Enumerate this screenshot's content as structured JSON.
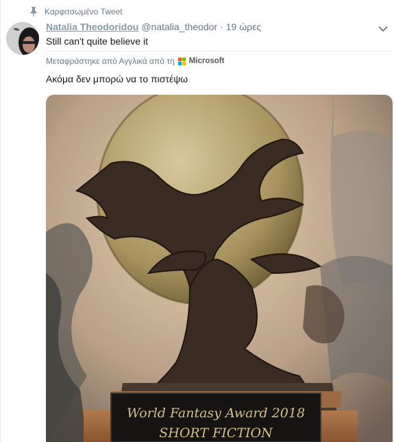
{
  "pinned": {
    "label": "Καρφιτσωμένο Tweet",
    "icon": "pin-icon"
  },
  "tweet": {
    "display_name": "Natalia Theodoridou",
    "handle": "@natalia_theodor",
    "separator": "·",
    "time": "19 ώρες",
    "text": "Still can't quite believe it",
    "menu_icon": "chevron-down-icon"
  },
  "translation": {
    "credit": "Μεταφράστηκε από Αγγλικά από τη",
    "provider": "Microsoft",
    "text": "Ακόμα δεν μπορώ να το πιστέψω"
  },
  "media": {
    "plaque_line1": "World Fantasy Award 2018",
    "plaque_line2": "SHORT FICTION"
  },
  "colors": {
    "muted": "#657786",
    "name": "#8899a6",
    "border": "#e6ecf0",
    "ms_red": "#f25022",
    "ms_green": "#7fba00",
    "ms_blue": "#00a4ef",
    "ms_yellow": "#ffb900"
  }
}
